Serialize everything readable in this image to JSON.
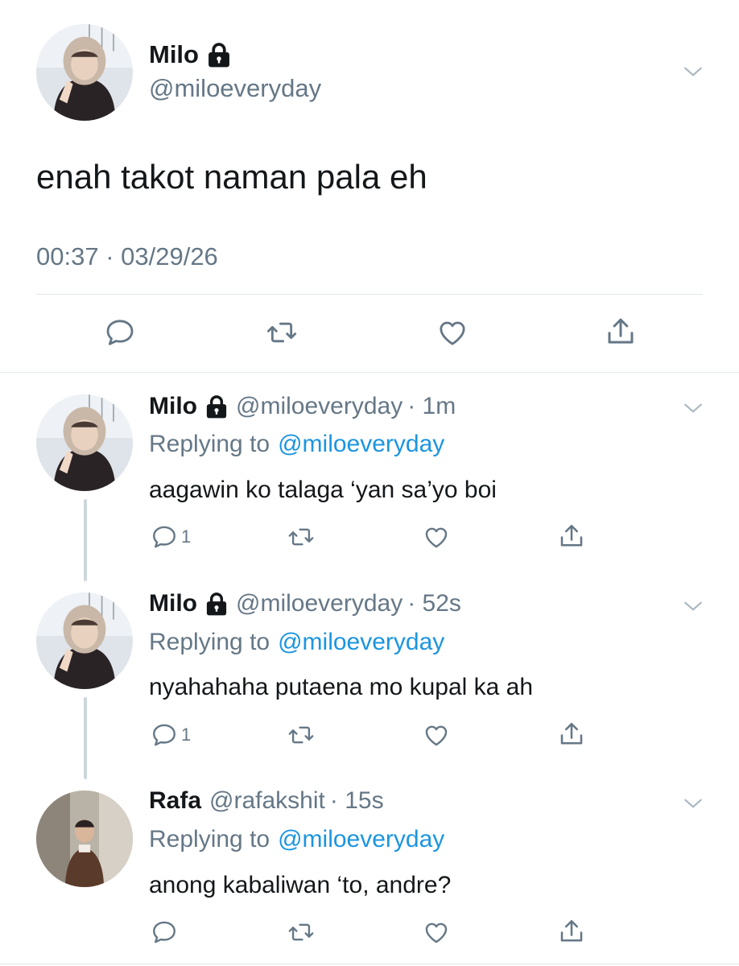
{
  "main_tweet": {
    "name": "Milo",
    "handle": "@miloeveryday",
    "text": "enah takot naman pala eh",
    "timestamp": "00:37 · 03/29/26"
  },
  "replies": [
    {
      "name": "Milo",
      "handle": "@miloeveryday",
      "time": "· 1m",
      "replying_label": "Replying to",
      "replying_to": "@miloeveryday",
      "text": "aagawin ko talaga ‘yan sa’yo boi",
      "reply_count": "1"
    },
    {
      "name": "Milo",
      "handle": "@miloeveryday",
      "time": "· 52s",
      "replying_label": "Replying to",
      "replying_to": "@miloeveryday",
      "text": "nyahahaha putaena mo kupal ka ah",
      "reply_count": "1"
    },
    {
      "name": "Rafa",
      "handle": "@rafakshit",
      "time": "· 15s",
      "replying_label": "Replying to",
      "replying_to": "@miloeveryday",
      "text": "anong kabaliwan ‘to, andre?",
      "reply_count": ""
    }
  ],
  "icons": {
    "reply": "comment-icon",
    "retweet": "retweet-icon",
    "like": "heart-icon",
    "share": "share-icon",
    "menu": "chevron-down-icon",
    "protected": "lock-icon"
  },
  "colors": {
    "text": "#14171a",
    "secondary": "#657786",
    "link": "#1b95e0",
    "divider": "#e1e8ed",
    "thread": "#ccd6dd"
  }
}
